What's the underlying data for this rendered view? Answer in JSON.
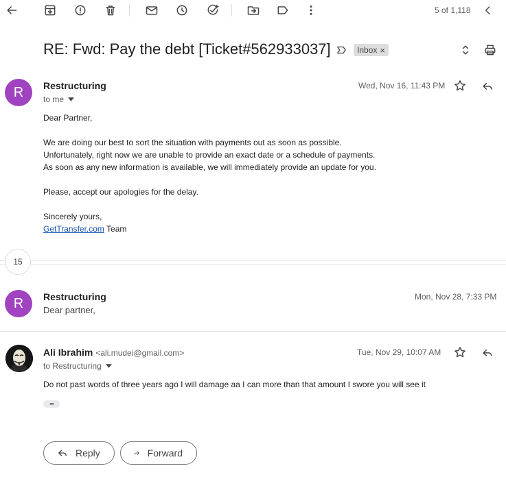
{
  "toolbar": {
    "counter": "5 of 1,118"
  },
  "thread": {
    "subject": "RE: Fwd: Pay the debt [Ticket#562933037]",
    "label": "Inbox",
    "label_remove": "×"
  },
  "message1": {
    "avatar_letter": "R",
    "sender": "Restructuring",
    "recipient": "to me",
    "date": "Wed, Nov 16, 11:43 PM",
    "greeting": "Dear Partner,",
    "para1": [
      "We are doing our best to sort the situation with payments out as soon as possible.",
      "Unfortunately, right now we are unable to provide an exact date or a schedule of payments.",
      "As soon as any new information is available, we will immediately provide an update for you."
    ],
    "para2": "Please, accept our apologies for the delay.",
    "signoff": "Sincerely yours,",
    "link_text": "GetTransfer.com",
    "signoff_team": " Team"
  },
  "collapsed": {
    "count": "15"
  },
  "message2": {
    "avatar_letter": "R",
    "sender": "Restructuring",
    "date": "Mon, Nov 28, 7:33 PM",
    "snippet": "Dear partner,"
  },
  "message3": {
    "sender": "Ali Ibrahim",
    "email": "<ali.mudei@gmail.com>",
    "recipient": "to Restructuring",
    "date": "Tue, Nov 29, 10:07 AM",
    "body": "Do not past words of three years ago I will damage aa I can more than that amount I swore you will see it",
    "ellipsis": "•••"
  },
  "actions": {
    "reply": "Reply",
    "forward": "Forward"
  }
}
